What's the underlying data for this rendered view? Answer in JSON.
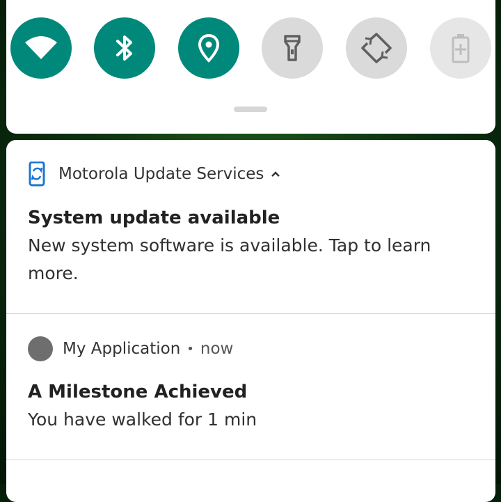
{
  "quick_settings": {
    "tiles": [
      {
        "name": "wifi",
        "state": "on",
        "icon": "wifi-icon"
      },
      {
        "name": "bluetooth",
        "state": "on",
        "icon": "bluetooth-icon"
      },
      {
        "name": "location",
        "state": "on",
        "icon": "location-icon"
      },
      {
        "name": "flashlight",
        "state": "off",
        "icon": "flashlight-icon"
      },
      {
        "name": "auto-rotate",
        "state": "off",
        "icon": "auto-rotate-icon"
      },
      {
        "name": "battery-saver",
        "state": "disabled",
        "icon": "battery-saver-icon"
      }
    ],
    "accent_color": "#00897b",
    "off_color": "#dadada"
  },
  "notifications": [
    {
      "app_name": "Motorola Update Services",
      "app_icon": "system-update-icon",
      "expanded": true,
      "title": "System update available",
      "text": "New system software is available. Tap to learn more."
    },
    {
      "app_name": "My Application",
      "app_icon": "app-avatar",
      "separator": "•",
      "time": "now",
      "title": "A Milestone Achieved",
      "text": "You have walked for 1 min"
    }
  ]
}
